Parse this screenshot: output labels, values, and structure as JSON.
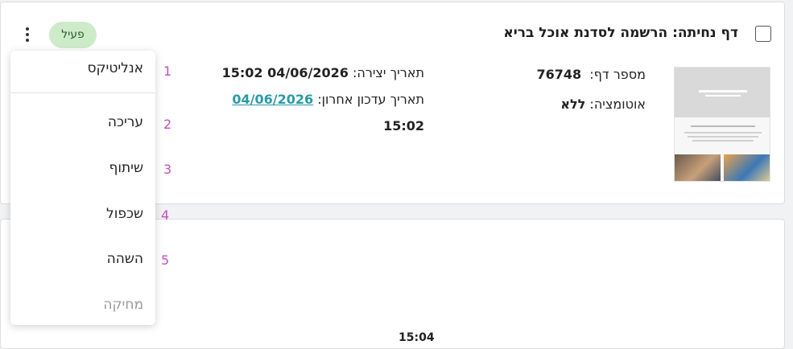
{
  "card": {
    "title": "דף נחיתה: הרשמה לסדנת אוכל בריא",
    "status_badge": "פעיל",
    "page_number_label": "מספר דף:",
    "page_number_value": "76748",
    "automation_label": "אוטומציה:",
    "automation_value": "ללא",
    "created_label": "תאריך יצירה:",
    "created_value": "15:02 04/06/2026",
    "updated_label": "תאריך עדכון אחרון:",
    "updated_date": "04/06/2026",
    "updated_time": "15:02"
  },
  "menu": {
    "items": [
      {
        "label": "אנליטיקס",
        "number": "1"
      },
      {
        "label": "עריכה",
        "number": "2"
      },
      {
        "label": "שיתוף",
        "number": "3"
      },
      {
        "label": "שכפול",
        "number": "4"
      },
      {
        "label": "השהה",
        "number": "5"
      },
      {
        "label": "מחיקה",
        "number": ""
      }
    ]
  },
  "card2": {
    "partial_time": "15:04"
  },
  "colors": {
    "badge_bg": "#cdebc9",
    "link": "#2a9aa8",
    "number_marker": "#c54fc0",
    "disabled": "#9a9a9a"
  },
  "icons": {
    "menu_trigger": "kebab-icon",
    "thumbnail": "landing-page-thumbnail"
  }
}
